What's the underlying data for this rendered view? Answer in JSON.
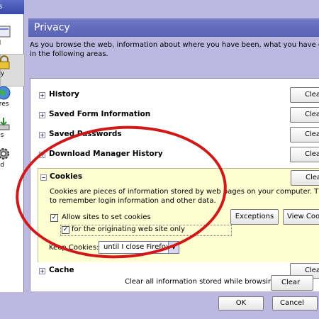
{
  "left_panel": {
    "title_fragment": "s",
    "categories": [
      {
        "label": "eral",
        "icon": "general-icon"
      },
      {
        "label": "vacy",
        "icon": "lock-icon"
      },
      {
        "label": "atures",
        "icon": "web-features-icon"
      },
      {
        "label": "oads",
        "icon": "downloads-icon"
      },
      {
        "label": "nced",
        "icon": "advanced-gear-icon"
      }
    ]
  },
  "privacy": {
    "heading": "Privacy",
    "intro_line1": "As you browse the web, information about where you have been, what you have done, etc is",
    "intro_line2": "in the following areas.",
    "items": [
      {
        "name": "History",
        "clear": "Clear"
      },
      {
        "name": "Saved Form Information",
        "clear": "Clear"
      },
      {
        "name": "Saved Passwords",
        "clear": "Clear"
      },
      {
        "name": "Download Manager History",
        "clear": "Clear"
      }
    ],
    "cookies": {
      "title": "Cookies",
      "clear": "Clear",
      "desc_line1": "Cookies are pieces of information stored by web pages on your computer. They are used",
      "desc_line2": "to remember login information and other data.",
      "allow_label": "Allow sites to set cookies",
      "origin_label": "for the originating web site only",
      "exceptions_label": "Exceptions",
      "view_label": "View Cookies",
      "keep_label": "Keep Cookies:",
      "keep_value": "until I close Firefox"
    },
    "cache": {
      "name": "Cache",
      "clear": "Clear"
    },
    "clear_all_label": "Clear all information stored while browsing:",
    "clear_all_button": "Clear"
  },
  "dialog_buttons": {
    "ok": "OK",
    "cancel": "Cancel"
  },
  "colors": {
    "highlight_oval": "#d01818",
    "heading_bg": "#6770be"
  }
}
